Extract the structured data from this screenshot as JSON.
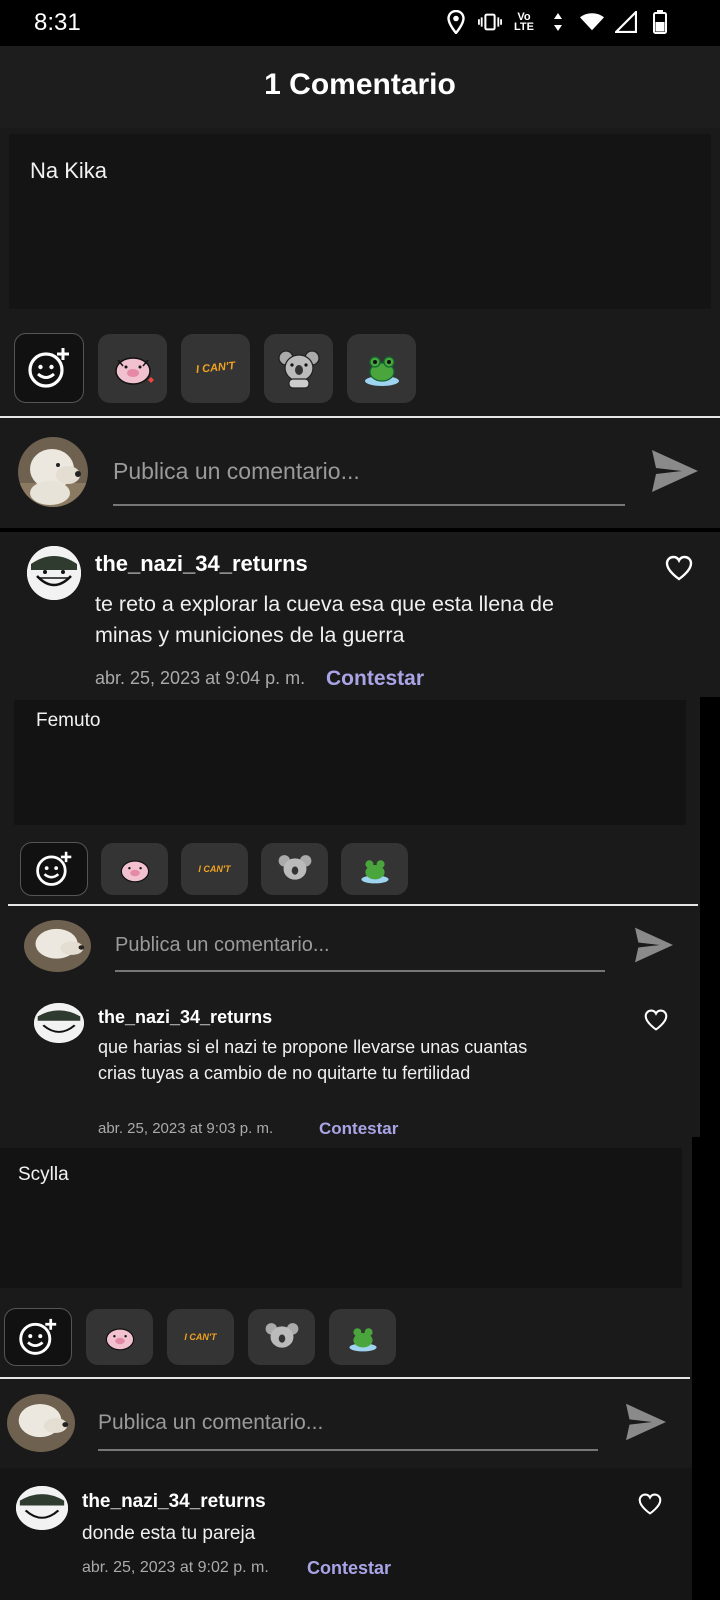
{
  "status": {
    "time": "8:31",
    "net": "Vo LTE"
  },
  "header": {
    "title": "1 Comentario"
  },
  "sections": [
    {
      "panel_text": "Na Kika",
      "input_placeholder": "Publica un comentario...",
      "comment": {
        "username": "the_nazi_34_returns",
        "text": "te reto a explorar la cueva esa que esta llena de minas y municiones de la guerra",
        "timestamp": "abr. 25, 2023 at 9:04 p. m.",
        "reply_label": "Contestar"
      }
    },
    {
      "panel_text": "Femuto",
      "input_placeholder": "Publica un comentario...",
      "comment": {
        "username": "the_nazi_34_returns",
        "text": "que harias si el nazi te propone llevarse unas cuantas crias tuyas a cambio de no quitarte tu fertilidad",
        "timestamp": "abr. 25, 2023 at 9:03 p. m.",
        "reply_label": "Contestar"
      }
    },
    {
      "panel_text": "Scylla",
      "input_placeholder": "Publica un comentario...",
      "comment": {
        "username": "the_nazi_34_returns",
        "text": "donde esta tu pareja",
        "timestamp": "abr. 25, 2023 at 9:02 p. m.",
        "reply_label": "Contestar"
      }
    }
  ],
  "stickers": {
    "icons": [
      "add-emoji-icon",
      "pig-sticker",
      "i-cant-sticker",
      "koala-sticker",
      "frog-sticker"
    ],
    "i_cant_text": "I CAN'T"
  },
  "colors": {
    "accent": "#a9a4e6",
    "background": "#000000",
    "panel": "#141414"
  }
}
